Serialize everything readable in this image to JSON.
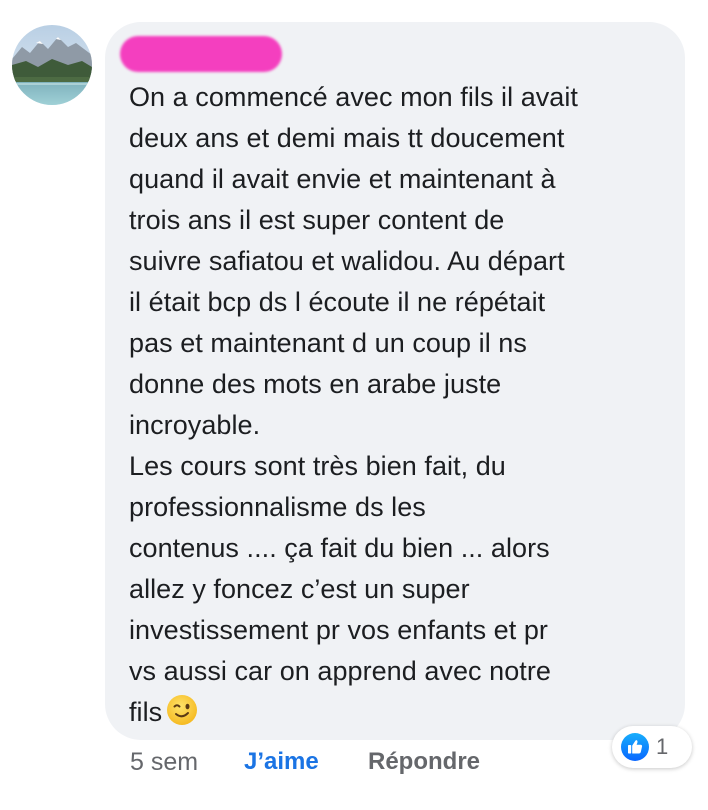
{
  "comment": {
    "lines": [
      "On a commencé avec mon fils il avait",
      "deux ans et demi mais tt doucement",
      "quand il avait envie et maintenant à",
      "trois ans il est super content de",
      "suivre safiatou et walidou. Au départ",
      "il était bcp ds l écoute il ne répétait",
      "pas et maintenant d un coup il ns",
      "donne des mots en arabe juste",
      "incroyable.",
      "Les cours sont très bien fait, du",
      "professionnalisme ds les",
      "contenus .... ça fait du bien ... alors",
      "allez y foncez c’est un super",
      "investissement pr vos enfants et pr",
      "vs aussi car on apprend avec notre",
      "fils"
    ],
    "emoji_icon": "winking-face-emoji"
  },
  "actions": {
    "timestamp": "5 sem",
    "like_label": "J’aime",
    "reply_label": "Répondre"
  },
  "reactions": {
    "icon": "like-thumbs-up-icon",
    "count": "1"
  },
  "colors": {
    "bubble": "#f0f2f5",
    "text": "#1c1e21",
    "muted": "#65676b",
    "like_blue": "#1b74e4",
    "name_redaction": "#f43fbf"
  }
}
